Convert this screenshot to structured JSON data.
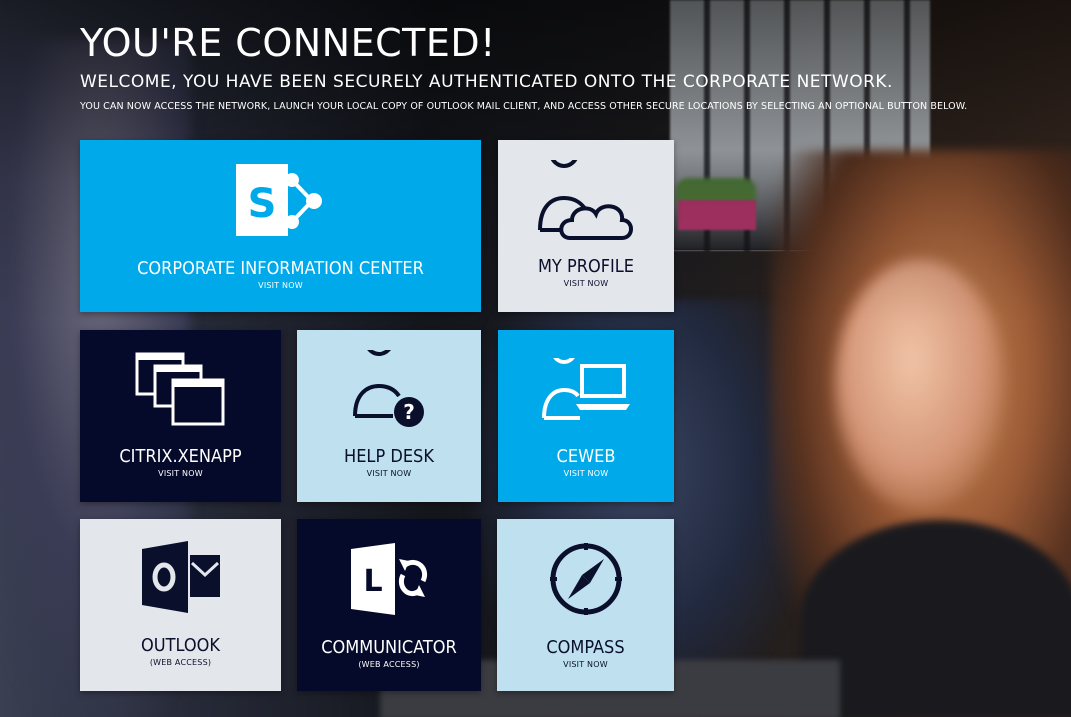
{
  "header": {
    "title": "YOU'RE CONNECTED!",
    "subtitle": "WELCOME, YOU HAVE BEEN SECURELY AUTHENTICATED ONTO THE CORPORATE NETWORK.",
    "description": "YOU CAN NOW ACCESS THE NETWORK, LAUNCH YOUR LOCAL COPY OF OUTLOOK MAIL CLIENT, AND ACCESS OTHER SECURE LOCATIONS BY SELECTING AN OPTIONAL BUTTON BELOW."
  },
  "tiles": [
    {
      "label": "CORPORATE INFORMATION CENTER",
      "sub": "VISIT NOW",
      "icon": "sharepoint-icon",
      "color": "#00a9ea"
    },
    {
      "label": "MY PROFILE",
      "sub": "VISIT NOW",
      "icon": "user-cloud-icon",
      "color": "#e3e7ec"
    },
    {
      "label": "CITRIX.XENAPP",
      "sub": "VISIT NOW",
      "icon": "windows-stack-icon",
      "color": "#05092a"
    },
    {
      "label": "HELP DESK",
      "sub": "VISIT NOW",
      "icon": "user-question-icon",
      "color": "#bfe0ee"
    },
    {
      "label": "CEWEB",
      "sub": "VISIT NOW",
      "icon": "user-laptop-icon",
      "color": "#00a9ea"
    },
    {
      "label": "OUTLOOK",
      "sub": "(WEB ACCESS)",
      "icon": "outlook-icon",
      "color": "#e3e7ec"
    },
    {
      "label": "COMMUNICATOR",
      "sub": "(WEB ACCESS)",
      "icon": "lync-icon",
      "color": "#05092a"
    },
    {
      "label": "COMPASS",
      "sub": "VISIT NOW",
      "icon": "compass-icon",
      "color": "#bfe0ee"
    }
  ]
}
